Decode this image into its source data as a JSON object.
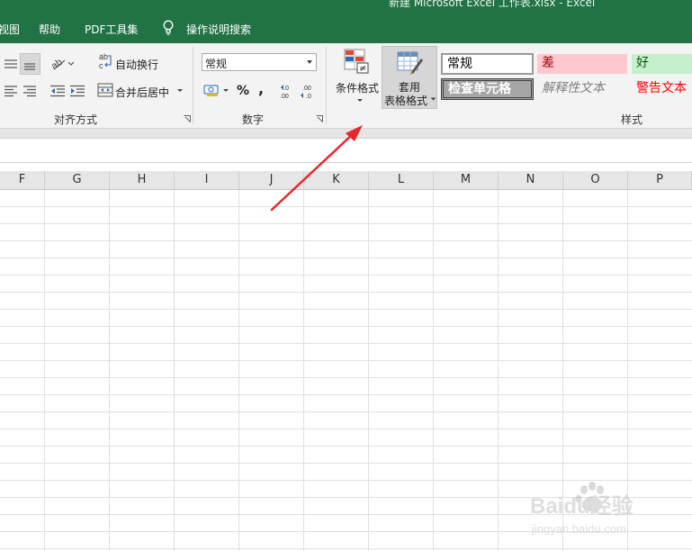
{
  "window": {
    "title": "新建 Microsoft Excel 工作表.xlsx  -  Excel"
  },
  "tabs": [
    {
      "label": "视图"
    },
    {
      "label": "帮助"
    },
    {
      "label": "PDF工具集"
    }
  ],
  "tell_me": {
    "label": "操作说明搜索"
  },
  "ribbon": {
    "alignment": {
      "wrap_text": "自动换行",
      "merge_center": "合并后居中",
      "group_label": "对齐方式"
    },
    "number": {
      "format_value": "常规",
      "percent": "%",
      "comma": ",",
      "group_label": "数字"
    },
    "styles": {
      "conditional_format": "条件格式",
      "format_as_table_line1": "套用",
      "format_as_table_line2": "表格格式",
      "cell_styles": [
        {
          "label": "常规",
          "bg": "#ffffff",
          "color": "#000000"
        },
        {
          "label": "差",
          "bg": "#ffc7ce",
          "color": "#9c0006"
        },
        {
          "label": "好",
          "bg": "#c6efce",
          "color": "#006100"
        },
        {
          "label": "检查单元格",
          "bg": "#a5a5a5",
          "color": "#ffffff"
        },
        {
          "label": "解释性文本",
          "bg": "#f3f3f3",
          "color": "#7f7f7f"
        },
        {
          "label": "警告文本",
          "bg": "#f3f3f3",
          "color": "#ff0000"
        }
      ],
      "group_label": "样式"
    }
  },
  "columns": [
    "F",
    "G",
    "H",
    "I",
    "J",
    "K",
    "L",
    "M",
    "N",
    "O",
    "P"
  ],
  "colors": {
    "excel_green": "#217346",
    "arrow_red": "#e8262c"
  },
  "watermark": {
    "brand": "Baidu经验",
    "url": "jingyan.baidu.com"
  }
}
